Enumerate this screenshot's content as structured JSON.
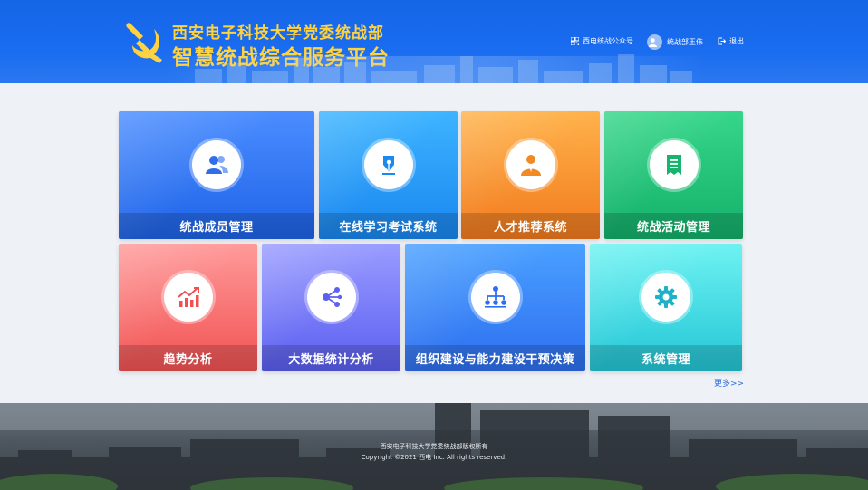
{
  "header": {
    "org_name": "西安电子科技大学党委统战部",
    "platform_name": "智慧统战综合服务平台",
    "wechat_label": "西电统战公众号",
    "user_label": "统战部王伟",
    "logout_label": "退出"
  },
  "tiles": [
    {
      "label": "统战成员管理",
      "icon": "users-icon",
      "color_start": "#4b8dff",
      "color_end": "#1e63e8"
    },
    {
      "label": "在线学习考试系统",
      "icon": "pen-nib-icon",
      "color_start": "#3db4ff",
      "color_end": "#1a86f0"
    },
    {
      "label": "人才推荐系统",
      "icon": "person-icon",
      "color_start": "#ffb24a",
      "color_end": "#f27a1e"
    },
    {
      "label": "统战活动管理",
      "icon": "document-icon",
      "color_start": "#36d68a",
      "color_end": "#14b06a"
    },
    {
      "label": "趋势分析",
      "icon": "trend-chart-icon",
      "color_start": "#ff9a9a",
      "color_end": "#f25252"
    },
    {
      "label": "大数据统计分析",
      "icon": "share-nodes-icon",
      "color_start": "#9a9cff",
      "color_end": "#5a5ef0"
    },
    {
      "label": "组织建设与能力建设干预决策",
      "icon": "org-chart-icon",
      "color_start": "#4aa0ff",
      "color_end": "#2d6ef0"
    },
    {
      "label": "系统管理",
      "icon": "gear-icon",
      "color_start": "#6ef2f2",
      "color_end": "#22c6d6"
    }
  ],
  "more_label": "更多>>",
  "footer": {
    "copyright_line1": "西安电子科技大学党委统战部版权所有",
    "copyright_line2": "Copyright ©2021 西电 Inc. All rights reserved."
  },
  "colors": {
    "header_blue": "#1a6cf0",
    "title_yellow": "#ffd23f",
    "link_blue": "#2b6fe0"
  }
}
